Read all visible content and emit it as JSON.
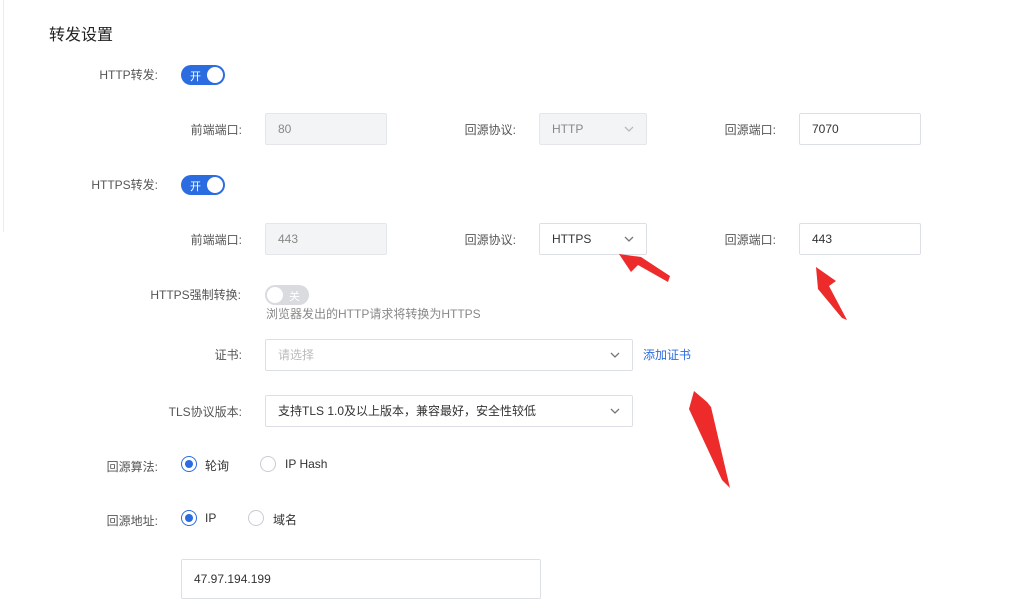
{
  "section_title": "转发设置",
  "http_forward": {
    "label": "HTTP转发:",
    "switch_text": "开",
    "enabled": true,
    "frontend_port_label": "前端端口:",
    "frontend_port_value": "80",
    "origin_protocol_label": "回源协议:",
    "origin_protocol_value": "HTTP",
    "origin_port_label": "回源端口:",
    "origin_port_value": "7070"
  },
  "https_forward": {
    "label": "HTTPS转发:",
    "switch_text": "开",
    "enabled": true,
    "frontend_port_label": "前端端口:",
    "frontend_port_value": "443",
    "origin_protocol_label": "回源协议:",
    "origin_protocol_value": "HTTPS",
    "origin_port_label": "回源端口:",
    "origin_port_value": "443"
  },
  "https_force": {
    "label": "HTTPS强制转换:",
    "switch_text": "关",
    "enabled": false,
    "hint": "浏览器发出的HTTP请求将转换为HTTPS"
  },
  "certificate": {
    "label": "证书:",
    "placeholder": "请选择",
    "add_link": "添加证书"
  },
  "tls": {
    "label": "TLS协议版本:",
    "value": "支持TLS 1.0及以上版本，兼容最好，安全性较低"
  },
  "origin_algorithm": {
    "label": "回源算法:",
    "options": [
      {
        "label": "轮询",
        "checked": true
      },
      {
        "label": "IP Hash",
        "checked": false
      }
    ]
  },
  "origin_address": {
    "label": "回源地址:",
    "options": [
      {
        "label": "IP",
        "checked": true
      },
      {
        "label": "域名",
        "checked": false
      }
    ],
    "ip_value": "47.97.194.199"
  },
  "colors": {
    "accent": "#2b6de0",
    "annotation_arrow": "#ee2b2b"
  }
}
